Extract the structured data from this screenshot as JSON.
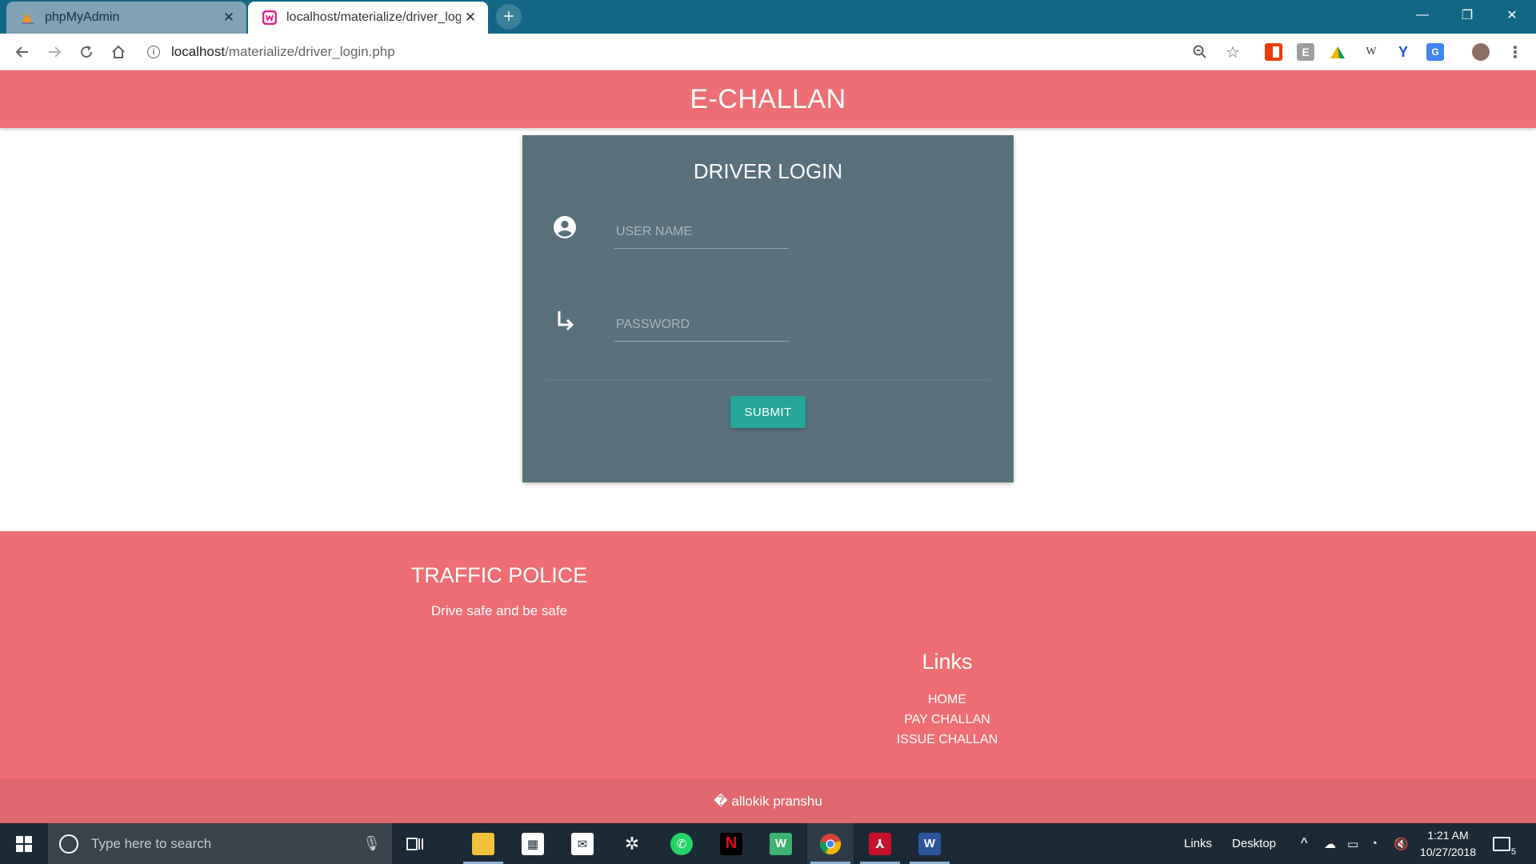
{
  "browser": {
    "tabs": [
      {
        "title": "phpMyAdmin",
        "active": false
      },
      {
        "title": "localhost/materialize/driver_login",
        "active": true
      }
    ],
    "new_tab": "+",
    "address": {
      "host": "localhost",
      "path": "/materialize/driver_login.php"
    },
    "window_controls": {
      "minimize": "—",
      "restore": "❐",
      "close": "✕"
    },
    "extensions": [
      "zoom-icon",
      "star-icon",
      "office-icon",
      "e-ext-icon",
      "keep-icon",
      "w-ext-icon",
      "y-ext-icon",
      "translate-icon",
      "profile-icon",
      "menu-icon"
    ]
  },
  "page": {
    "brand": "E-CHALLAN",
    "login": {
      "title": "DRIVER LOGIN",
      "username_placeholder": "USER NAME",
      "password_placeholder": "PASSWORD",
      "submit": "SUBMIT"
    },
    "footer": {
      "title": "TRAFFIC POLICE",
      "subtitle": "Drive safe and be safe",
      "links_title": "Links",
      "links": [
        "HOME",
        "PAY CHALLAN",
        "ISSUE CHALLAN"
      ],
      "copyright": "� allokik pranshu"
    }
  },
  "taskbar": {
    "search_placeholder": "Type here to search",
    "toolbars": [
      "Links",
      "Desktop"
    ],
    "time": "1:21 AM",
    "date": "10/27/2018",
    "notification_count": "5",
    "accent": "#26a69a",
    "brand_color": "#ef6e73",
    "card_color": "#58707c"
  }
}
